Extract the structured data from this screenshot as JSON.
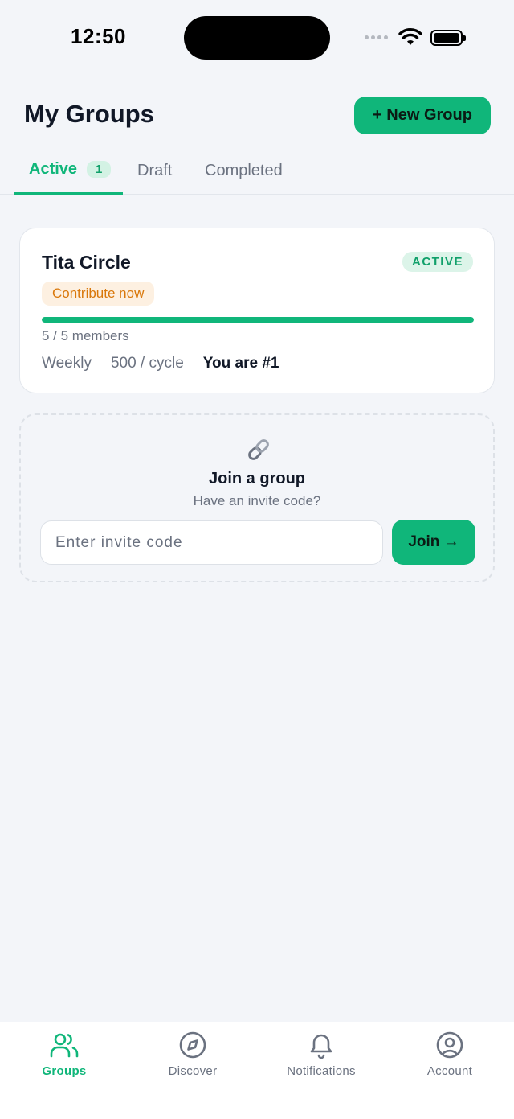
{
  "status_bar": {
    "time": "12:50"
  },
  "header": {
    "title": "My Groups",
    "new_group_label": "+ New Group"
  },
  "tabs": [
    {
      "label": "Active",
      "count": "1"
    },
    {
      "label": "Draft"
    },
    {
      "label": "Completed"
    }
  ],
  "group_card": {
    "name": "Tita Circle",
    "status": "ACTIVE",
    "action_pill": "Contribute now",
    "progress": 1.0,
    "members": "5 / 5 members",
    "frequency": "Weekly",
    "amount": "500 / cycle",
    "position": "You are #1"
  },
  "join_card": {
    "icon": "link-icon",
    "title": "Join a group",
    "subtitle": "Have an invite code?",
    "input_placeholder": "Enter invite code",
    "button_label": "Join →"
  },
  "bottom_nav": [
    {
      "label": "Groups",
      "icon": "users-icon",
      "active": true
    },
    {
      "label": "Discover",
      "icon": "compass-icon",
      "active": false
    },
    {
      "label": "Notifications",
      "icon": "bell-icon",
      "active": false
    },
    {
      "label": "Account",
      "icon": "user-circle-icon",
      "active": false
    }
  ],
  "colors": {
    "accent": "#10b67a",
    "background": "#f3f5f9",
    "warning": "#d9770a"
  }
}
